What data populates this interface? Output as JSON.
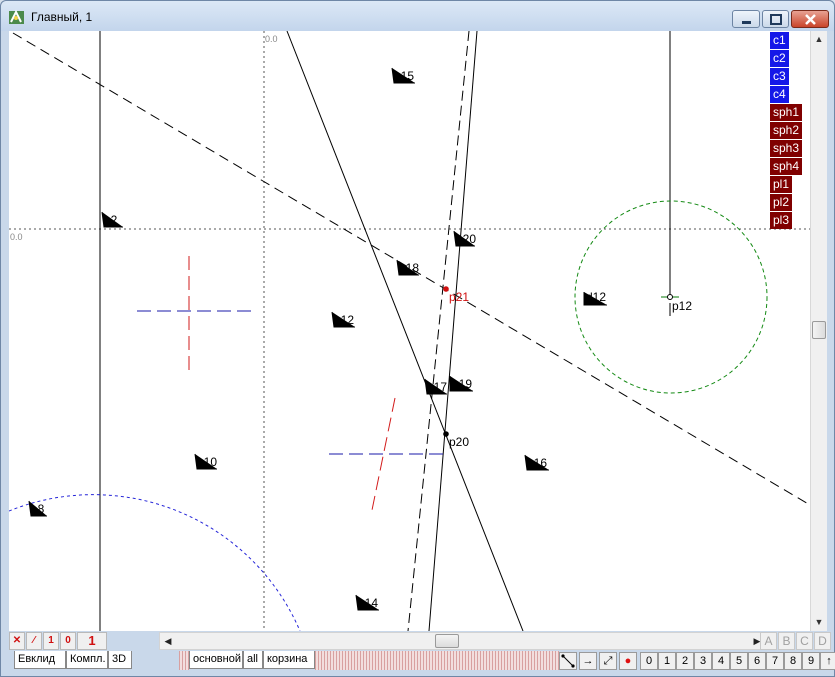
{
  "window": {
    "title": "Главный, 1",
    "buttons": [
      "minimize",
      "maximize",
      "close"
    ]
  },
  "canvas": {
    "axis_labels": {
      "x_origin": "0.0",
      "y_origin": "0.0"
    },
    "labels": [
      "o15",
      "o2",
      "o20",
      "o18",
      "p21",
      "d12",
      "p12",
      "o12",
      "o17",
      "o19",
      "p20",
      "o10",
      "o16",
      "o8",
      "o14"
    ]
  },
  "side_labels": [
    {
      "text": "c1",
      "color": "#1518e8"
    },
    {
      "text": "c2",
      "color": "#1518e8"
    },
    {
      "text": "c3",
      "color": "#1518e8"
    },
    {
      "text": "c4",
      "color": "#1518e8"
    },
    {
      "text": "sph1",
      "color": "#800000"
    },
    {
      "text": "sph2",
      "color": "#800000"
    },
    {
      "text": "sph3",
      "color": "#800000"
    },
    {
      "text": "sph4",
      "color": "#800000"
    },
    {
      "text": "pl1",
      "color": "#800000"
    },
    {
      "text": "pl2",
      "color": "#800000"
    },
    {
      "text": "pl3",
      "color": "#800000"
    }
  ],
  "bottom_left_buttons": [
    "✕",
    "⁄",
    "1",
    "0"
  ],
  "counter": "1",
  "letter_buttons": [
    "A",
    "B",
    "C",
    "D"
  ],
  "mode_tabs": [
    "Евклид",
    "Компл.",
    "3D"
  ],
  "layer_tabs": [
    "основной",
    "all",
    "корзина"
  ],
  "tool_icons": [
    "segment-tool-icon",
    "arrow-right-icon",
    "resize-icon",
    "record-icon"
  ],
  "digit_buttons": [
    "0",
    "1",
    "2",
    "3",
    "4",
    "5",
    "6",
    "7",
    "8",
    "9",
    "↑"
  ]
}
